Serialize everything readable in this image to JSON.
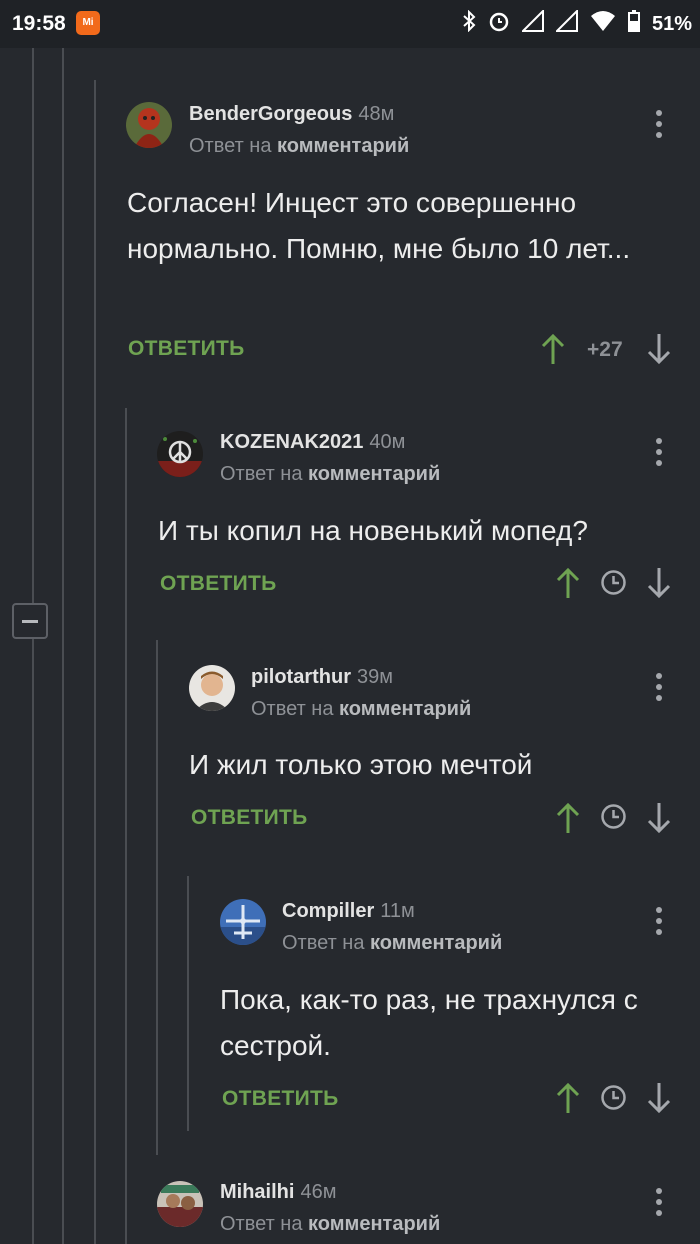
{
  "status_bar": {
    "time": "19:58",
    "mi_label": "Mi",
    "battery": "51%"
  },
  "reply_prefix": "Ответ на",
  "reply_link": "комментарий",
  "answer_label": "ОТВЕТИТЬ",
  "comments": [
    {
      "user": "BenderGorgeous",
      "time": "48м",
      "text": "Согласен! Инцест это совершенно нормально. Помню, мне было 10 лет...",
      "rating": "+27"
    },
    {
      "user": "KOZENAK2021",
      "time": "40м",
      "text": "И ты копил на новенький мопед?"
    },
    {
      "user": "pilotarthur",
      "time": "39м",
      "text": "И жил только этою мечтой"
    },
    {
      "user": "Compiller",
      "time": "11м",
      "text": "Пока, как-то раз, не трахнулся с сестрой."
    },
    {
      "user": "Mihailhi",
      "time": "46м"
    }
  ],
  "colors": {
    "background": "#26292e",
    "accent_green": "#6fa352",
    "muted": "#8e9196"
  }
}
